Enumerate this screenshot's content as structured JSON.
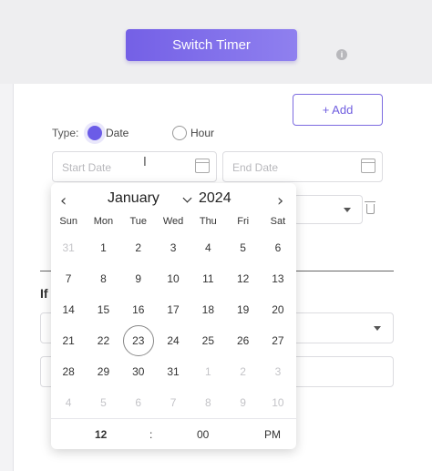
{
  "header": {
    "switch_timer_label": "Switch Timer",
    "info_glyph": "i"
  },
  "form": {
    "add_label": "+ Add",
    "type_label": "Type:",
    "type_options": [
      "Date",
      "Hour"
    ],
    "selected_type": "Date",
    "start_date_placeholder": "Start Date",
    "end_date_placeholder": "End Date",
    "cursor_glyph": "I",
    "if_label": "If"
  },
  "datepicker": {
    "prev_glyph": "‹",
    "next_glyph": "›",
    "month": "January",
    "year": "2024",
    "weekdays": [
      "Sun",
      "Mon",
      "Tue",
      "Wed",
      "Thu",
      "Fri",
      "Sat"
    ],
    "weeks": [
      [
        "31",
        "1",
        "2",
        "3",
        "4",
        "5",
        "6"
      ],
      [
        "7",
        "8",
        "9",
        "10",
        "11",
        "12",
        "13"
      ],
      [
        "14",
        "15",
        "16",
        "17",
        "18",
        "19",
        "20"
      ],
      [
        "21",
        "22",
        "23",
        "24",
        "25",
        "26",
        "27"
      ],
      [
        "28",
        "29",
        "30",
        "31",
        "1",
        "2",
        "3"
      ],
      [
        "4",
        "5",
        "6",
        "7",
        "8",
        "9",
        "10"
      ]
    ],
    "selected_day": "23",
    "time": {
      "hour": "12",
      "separator": ":",
      "minute": "00",
      "period": "PM"
    }
  },
  "colors": {
    "accent": "#6b5ce7",
    "button_gradient_start": "#7460e6",
    "button_gradient_end": "#8f80ef"
  },
  "icons": [
    "info-icon",
    "calendar-icon",
    "chevron-left-icon",
    "chevron-right-icon",
    "chevron-down-icon",
    "trash-icon"
  ]
}
